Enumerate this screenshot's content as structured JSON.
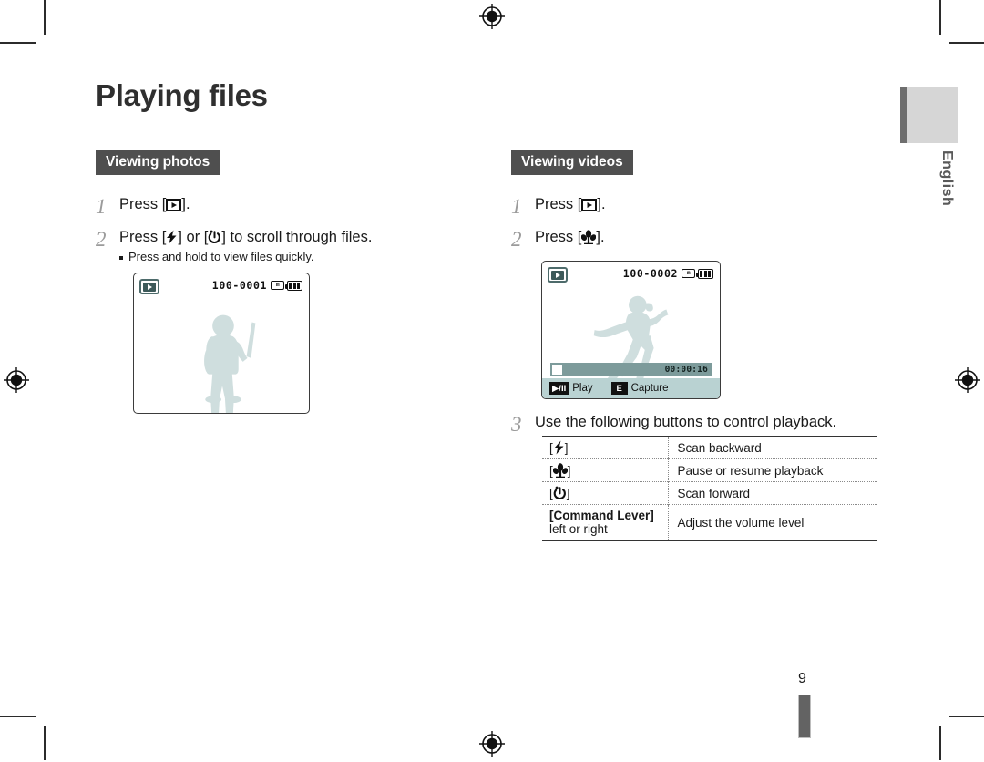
{
  "page": {
    "title": "Playing files",
    "number": "9",
    "language_tab": "English"
  },
  "left_column": {
    "section_heading": "Viewing photos",
    "steps": [
      {
        "number": "1",
        "text_before": "Press [",
        "icon": "playback-icon",
        "text_after": "]."
      },
      {
        "number": "2",
        "text_before": "Press [",
        "icon": "flash-icon",
        "text_middle": "] or [",
        "icon2": "timer-icon",
        "text_after": "] to scroll through files.",
        "bullet": "Press and hold to view files quickly."
      }
    ],
    "screen": {
      "badge_icon": "playback-badge-icon",
      "file_number": "100-0001",
      "card_icon_label": "m",
      "card_icon": "memory-card-icon",
      "battery_icon": "battery-full-icon",
      "subject": "standing-person-silhouette"
    }
  },
  "right_column": {
    "section_heading": "Viewing videos",
    "steps": [
      {
        "number": "1",
        "text_before": "Press [",
        "icon": "playback-icon",
        "text_after": "]."
      },
      {
        "number": "2",
        "text_before": "Press [",
        "icon": "macro-icon",
        "text_after": "]."
      },
      {
        "number": "3",
        "text": "Use the following buttons to control playback."
      }
    ],
    "screen": {
      "badge_icon": "playback-badge-icon",
      "file_number": "100-0002",
      "card_icon_label": "m",
      "card_icon": "memory-card-icon",
      "battery_icon": "battery-full-icon",
      "subject": "dancing-person-silhouette",
      "progress_time": "00:00:16",
      "controls": [
        {
          "key_icon": "play-pause-icon",
          "key_label": "▶/II",
          "label": "Play"
        },
        {
          "key_icon": "capture-key-icon",
          "key_label": "E",
          "label": "Capture"
        }
      ]
    },
    "control_table": {
      "rows": [
        {
          "key_icon": "flash-icon",
          "key_open": "[",
          "key_close": "]",
          "action": "Scan backward"
        },
        {
          "key_icon": "macro-icon",
          "key_open": "[",
          "key_close": "]",
          "action": "Pause or resume playback"
        },
        {
          "key_icon": "timer-icon",
          "key_open": "[",
          "key_close": "]",
          "action": "Scan forward"
        },
        {
          "key_text": "[Command Lever]",
          "key_text_bold": "Command Lever",
          "key_line2": "left or right",
          "action": "Adjust the volume level"
        }
      ]
    }
  },
  "colors": {
    "heading_badge": "#4f4f4f",
    "step_number": "#9b9b9b",
    "lcd_border": "#3b3b3b",
    "silhouette": "#cfdede",
    "progress_bar": "#7d9b9b",
    "control_bar": "#b9d2d2",
    "language_tab_block": "#d6d6d6",
    "language_tab_bar": "#6e6e6e"
  }
}
